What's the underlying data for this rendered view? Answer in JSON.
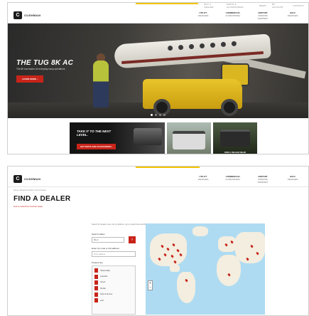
{
  "home": {
    "utility_links": [
      "BUY A DEALER",
      "PARTS & ACCESSORIES",
      "NEWS",
      "MY ACCOUNT",
      "CONTACT"
    ],
    "logo": {
      "mark": "C",
      "name": "CUSHMAN",
      "tagline": ""
    },
    "nav": [
      {
        "label": "UTILITY",
        "sub": "VEHICLES"
      },
      {
        "label": "COMMERCIAL",
        "sub": "& INDUSTRIAL"
      },
      {
        "label": "AIRPORT",
        "sub": "GROUND SUPPORT"
      },
      {
        "label": "GOLF",
        "sub": "VEHICLES"
      }
    ],
    "hero": {
      "title": "THE TUG 8K AC",
      "subtitle": "The 8K tow tractor for everyday ramp operations.",
      "button": "LEARN MORE ›",
      "slides": 4,
      "active_slide": 1
    },
    "tiles": {
      "feature_title": "TAKE IT TO THE NEXT LEVEL.",
      "feature_button": "GET PARTS AND ACCESSORIES ›",
      "dealer_caption": "FIND A DEALER NEAR"
    }
  },
  "dealer_page": {
    "logo": {
      "mark": "C",
      "name": "CUSHMAN"
    },
    "nav": [
      {
        "label": "UTILITY",
        "sub": "VEHICLES"
      },
      {
        "label": "COMMERCIAL",
        "sub": "& INDUSTRIAL"
      },
      {
        "label": "AIRPORT",
        "sub": "GROUND SUPPORT"
      },
      {
        "label": "GOLF",
        "sub": "VEHICLES"
      }
    ],
    "breadcrumb": "Home  /  Resource Finder  /  Find a Dealer",
    "title": "FIND A DEALER",
    "sub_link": "Find an authorized Cushman dealer",
    "intro": "Search for dealers near you by address, city or postal code and filter by product line.",
    "search_radius_label": "Search radius",
    "search_radius_value": "50 mi",
    "go_button": "›",
    "address_label": "Enter zip code or full address",
    "address_placeholder": "Enter address",
    "product_line_label": "Product line",
    "product_lines": [
      "Hauler/Utility",
      "Industrial",
      "Airport",
      "Shuttle",
      "Parts & Service",
      "Golf"
    ],
    "zoom_in": "+",
    "zoom_out": "−"
  }
}
